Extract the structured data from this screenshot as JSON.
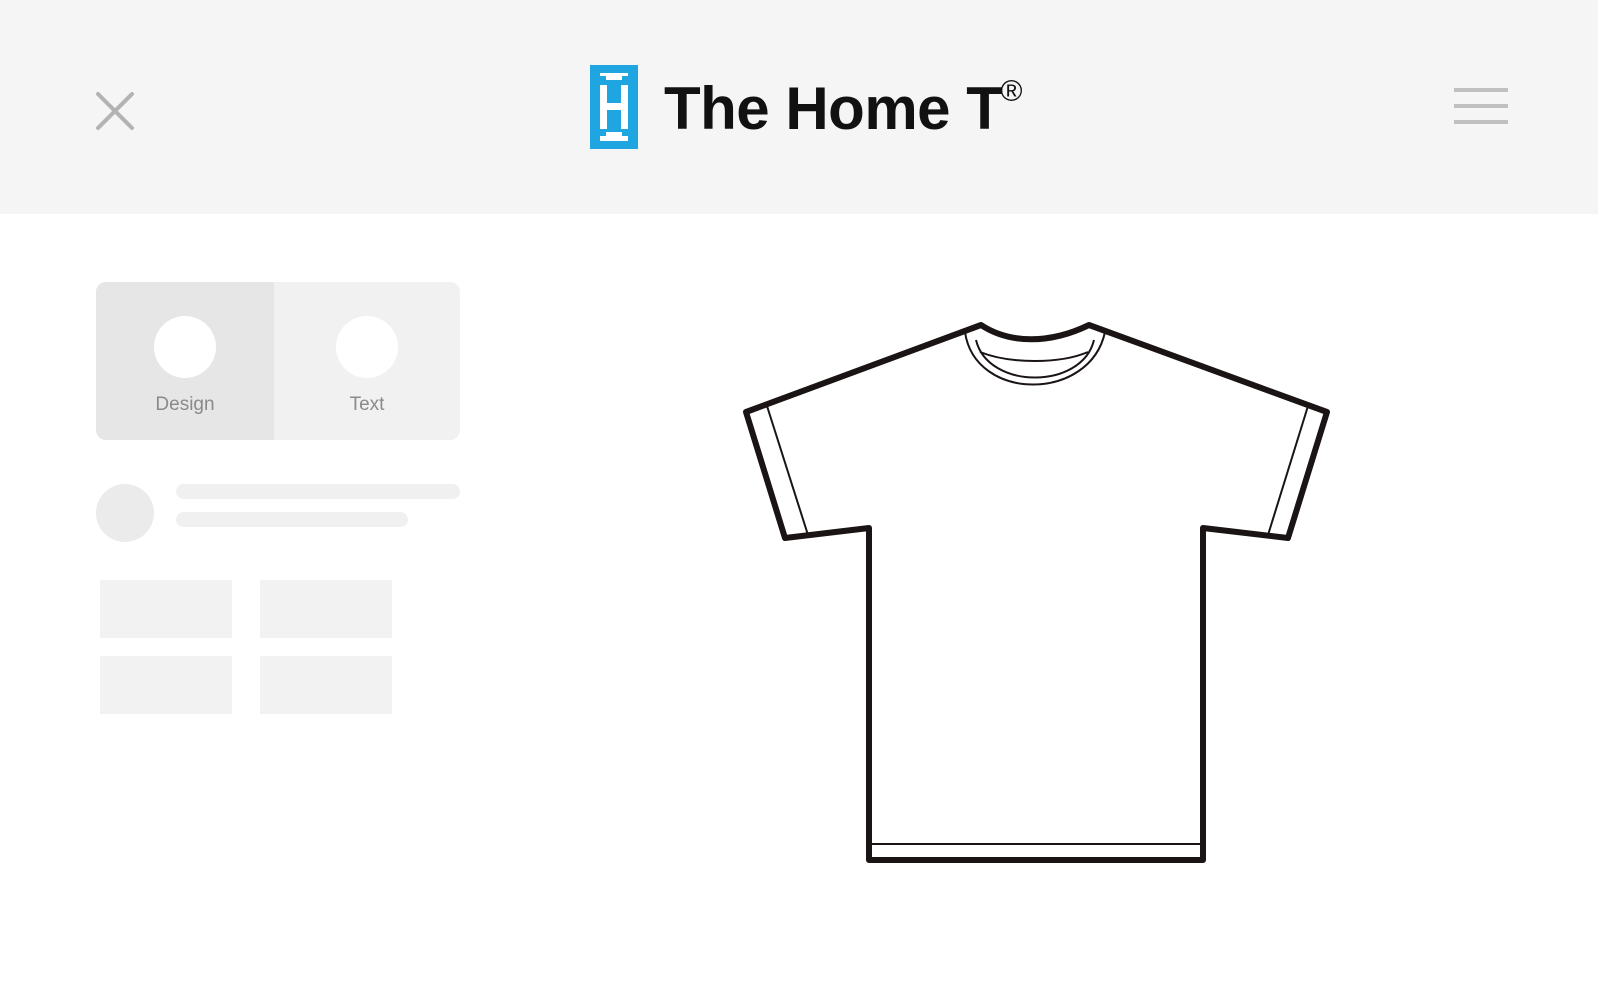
{
  "header": {
    "brand_name": "The Home T",
    "brand_mark": "®",
    "logo_letter": "H",
    "logo_color": "#1fa6e0",
    "close_icon": "close-icon",
    "menu_icon": "hamburger-menu-icon"
  },
  "tools": {
    "tabs": [
      {
        "label": "Design",
        "active": true
      },
      {
        "label": "Text",
        "active": false
      }
    ]
  },
  "canvas": {
    "product": "t-shirt-outline",
    "shirt_color": "#ffffff",
    "outline_color": "#1a1414"
  }
}
